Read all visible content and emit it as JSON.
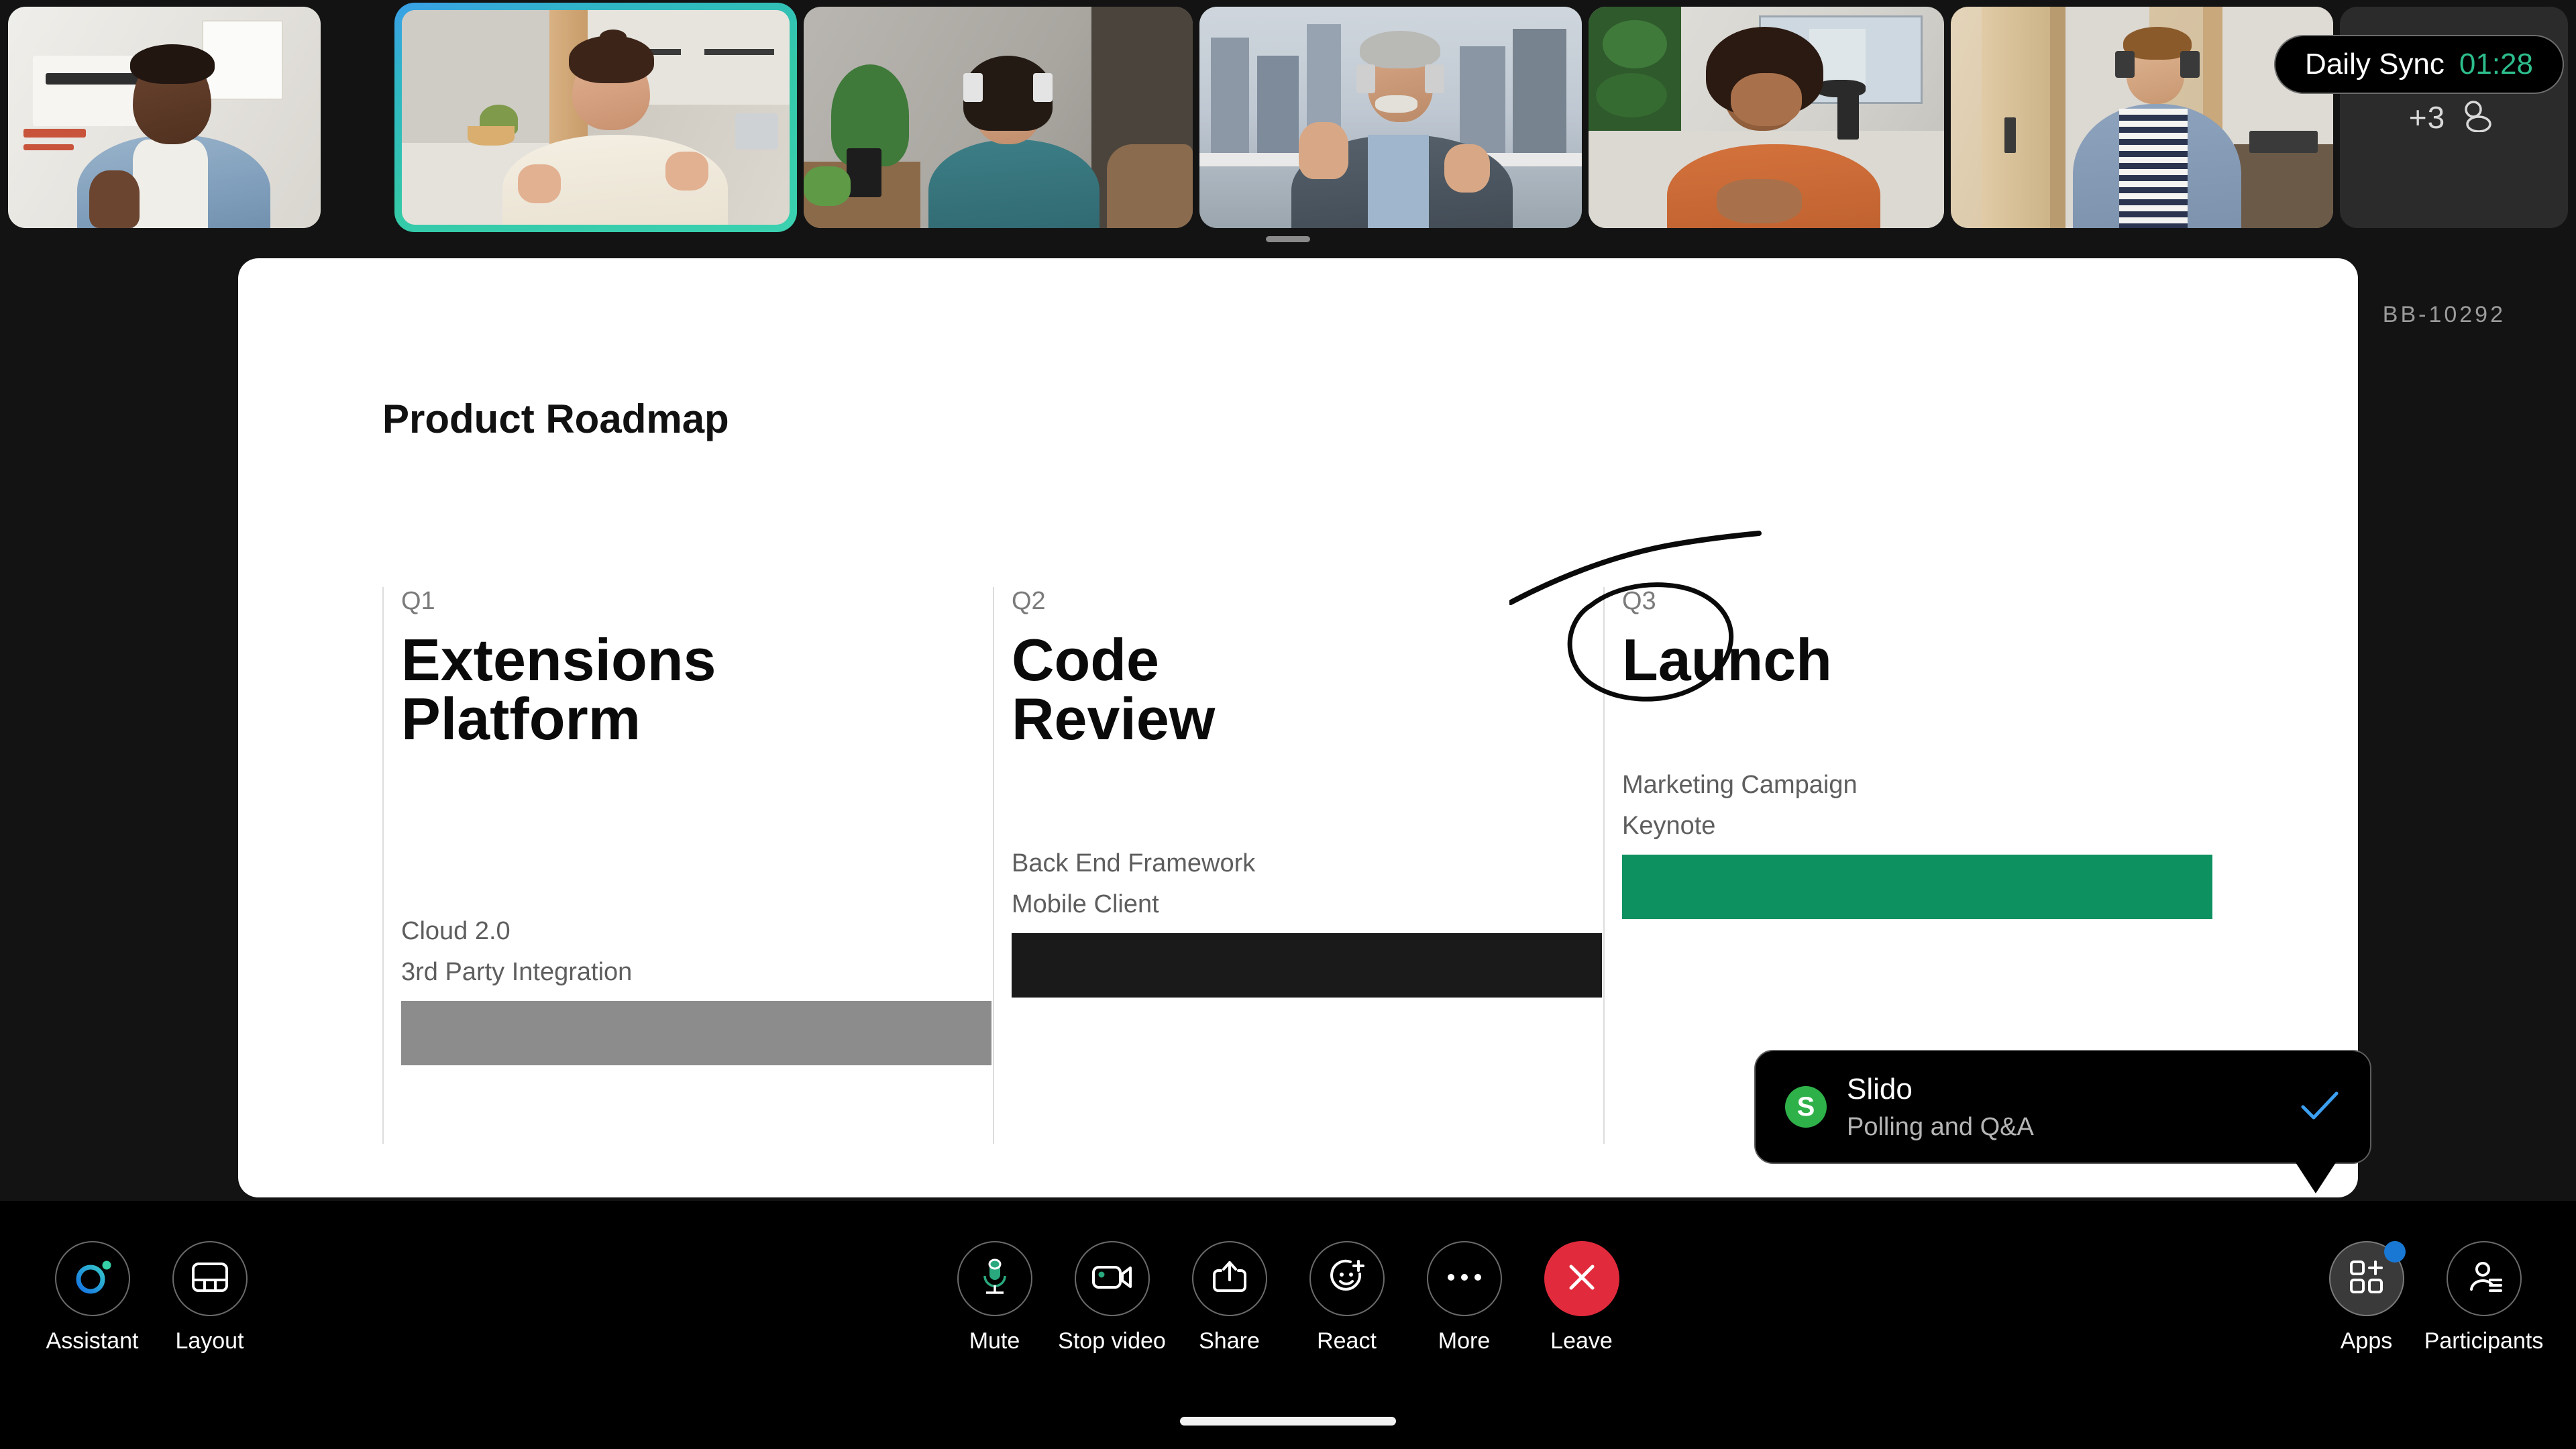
{
  "meeting": {
    "title": "Daily Sync",
    "elapsed": "01:28",
    "overflow_label": "+3",
    "overflow_icon": "people-icon"
  },
  "filmstrip": {
    "tiles": [
      {
        "name": "participant-1",
        "active": false
      },
      {
        "name": "participant-2",
        "active": true
      },
      {
        "name": "participant-3",
        "active": false
      },
      {
        "name": "participant-4",
        "active": false
      },
      {
        "name": "participant-5",
        "active": false
      },
      {
        "name": "participant-6",
        "active": false
      }
    ]
  },
  "slide": {
    "id": "BB-10292",
    "title": "Product Roadmap",
    "columns": [
      {
        "quarter": "Q1",
        "heading": "Extensions\nPlatform",
        "items": "Cloud 2.0\n3rd Party Integration",
        "bar_color": "#8c8c8c"
      },
      {
        "quarter": "Q2",
        "heading": "Code\nReview",
        "items": "Back End Framework\nMobile Client",
        "bar_color": "#1a1a1a"
      },
      {
        "quarter": "Q3",
        "heading": "Launch",
        "items": "Marketing Campaign\nKeynote",
        "bar_color": "#0d9160"
      }
    ],
    "annotation": "hand-drawn ellipse circling Q3 Launch"
  },
  "toast": {
    "app_initial": "S",
    "name": "Slido",
    "subtitle": "Polling and Q&A",
    "status_icon": "checkmark-icon",
    "accent": "#3c9ff0",
    "badge_color": "#2fb14a"
  },
  "toolbar": {
    "left": [
      {
        "label": "Assistant",
        "icon": "assistant-ring-icon",
        "state": "default"
      },
      {
        "label": "Layout",
        "icon": "layout-icon",
        "state": "default"
      }
    ],
    "center": [
      {
        "label": "Mute",
        "icon": "microphone-icon",
        "state": "default"
      },
      {
        "label": "Stop video",
        "icon": "camera-icon",
        "state": "default"
      },
      {
        "label": "Share",
        "icon": "share-icon",
        "state": "default"
      },
      {
        "label": "React",
        "icon": "smiley-plus-icon",
        "state": "default"
      },
      {
        "label": "More",
        "icon": "ellipsis-icon",
        "state": "default"
      },
      {
        "label": "Leave",
        "icon": "close-x-icon",
        "state": "danger"
      }
    ],
    "right": [
      {
        "label": "Apps",
        "icon": "apps-grid-plus-icon",
        "state": "active",
        "badge": true
      },
      {
        "label": "Participants",
        "icon": "participants-icon",
        "state": "default"
      }
    ]
  }
}
